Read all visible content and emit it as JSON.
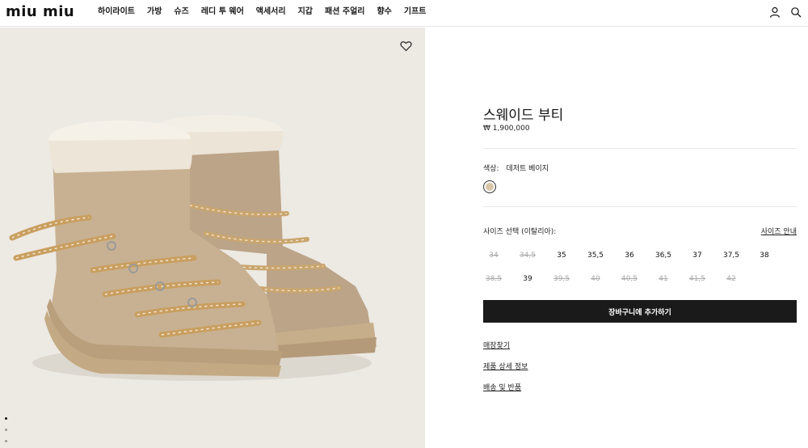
{
  "header": {
    "logo": "miu miu",
    "nav": [
      "하이라이트",
      "가방",
      "슈즈",
      "레디 투 웨어",
      "액세서리",
      "지갑",
      "패션 주얼리",
      "향수",
      "기프트"
    ],
    "icons": [
      "user-icon",
      "search-icon"
    ]
  },
  "gallery": {
    "wishlist_icon": "heart-icon",
    "dots": 3,
    "active_dot": 0,
    "background_color": "#ede9e3"
  },
  "product": {
    "title": "스웨이드 부티",
    "price": "₩ 1,900,000",
    "color_label": "색상:",
    "color_value": "데저트 베이지",
    "swatch_color": "#d8c6a8",
    "size_label": "사이즈 선택 (이탈리아):",
    "size_guide": "사이즈 안내",
    "sizes_row1": [
      {
        "label": "34",
        "available": false
      },
      {
        "label": "34,5",
        "available": false
      },
      {
        "label": "35",
        "available": true
      },
      {
        "label": "35,5",
        "available": true
      },
      {
        "label": "36",
        "available": true
      },
      {
        "label": "36,5",
        "available": true
      },
      {
        "label": "37",
        "available": true
      },
      {
        "label": "37,5",
        "available": true
      },
      {
        "label": "38",
        "available": true
      }
    ],
    "sizes_row2": [
      {
        "label": "38,5",
        "available": false
      },
      {
        "label": "39",
        "available": true
      },
      {
        "label": "39,5",
        "available": false
      },
      {
        "label": "40",
        "available": false
      },
      {
        "label": "40,5",
        "available": false
      },
      {
        "label": "41",
        "available": false
      },
      {
        "label": "41,5",
        "available": false
      },
      {
        "label": "42",
        "available": false
      }
    ],
    "add_to_cart": "장바구니에 추가하기",
    "links": [
      "매장찾기",
      "제품 상세 정보",
      "배송 및 반품"
    ]
  }
}
